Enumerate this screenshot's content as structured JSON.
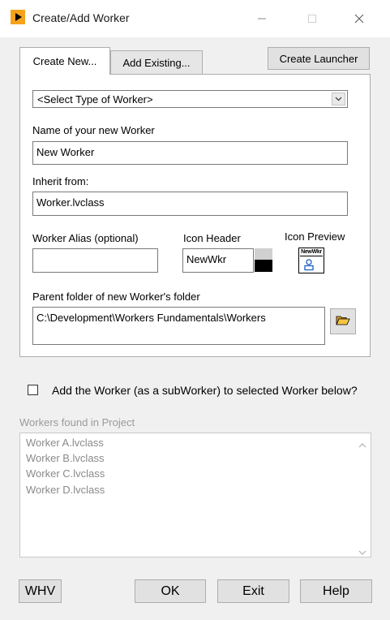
{
  "window": {
    "title": "Create/Add Worker"
  },
  "tabs": [
    {
      "label": "Create New...",
      "active": true
    },
    {
      "label": "Add Existing...",
      "active": false
    }
  ],
  "create_launcher_label": "Create Launcher",
  "worker_type": {
    "selected": "<Select Type of Worker>"
  },
  "name": {
    "label": "Name of your new Worker",
    "value": "New Worker"
  },
  "inherit": {
    "label": "Inherit from:",
    "value": "Worker.lvclass"
  },
  "alias": {
    "label": "Worker Alias (optional)",
    "value": ""
  },
  "icon_header": {
    "label": "Icon Header",
    "value": "NewWkr",
    "colors": [
      "#d0d0d0",
      "#000000"
    ]
  },
  "icon_preview": {
    "label": "Icon Preview",
    "text": "NewWkr"
  },
  "parent_folder": {
    "label": "Parent folder of new Worker's folder",
    "value": "C:\\Development\\Workers Fundamentals\\Workers"
  },
  "subworker": {
    "label": "Add the Worker (as a subWorker) to selected Worker below?",
    "checked": false
  },
  "project_workers": {
    "label": "Workers found in Project",
    "items": [
      "Worker A.lvclass",
      "Worker B.lvclass",
      "Worker C.lvclass",
      "Worker D.lvclass"
    ]
  },
  "buttons": {
    "whv": "WHV",
    "ok": "OK",
    "exit": "Exit",
    "help": "Help"
  },
  "colors": {
    "accent": "#f5a31a",
    "panel": "#f0f0f0",
    "button": "#e1e1e1",
    "disabled_text": "#8a8a8a"
  }
}
